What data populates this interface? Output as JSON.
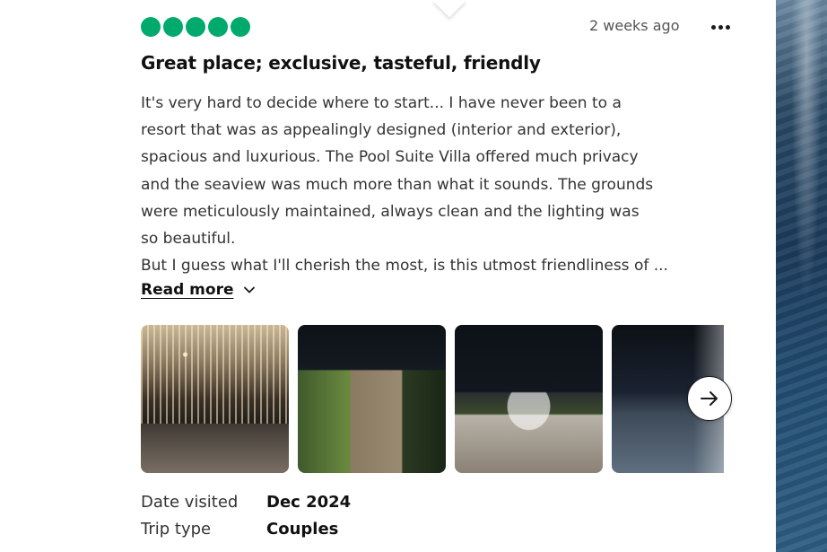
{
  "review": {
    "rating": 5,
    "rating_max": 5,
    "rating_color": "#00aa6c",
    "posted_ago": "2 weeks ago",
    "more_icon": "ellipsis-horizontal",
    "title": "Great place; exclusive, tasteful, friendly",
    "body_lines": [
      "It's very hard to decide where to start... I have never been to a",
      "resort that was as appealingly designed (interior and exterior),",
      "spacious and luxurious. The Pool Suite Villa offered much privacy",
      "and the seaview was much more than what it sounds. The grounds",
      "were meticulously maintained, always clean and the lighting was",
      "so beautiful.",
      "But I guess what I'll cherish the most, is this utmost friendliness of ..."
    ],
    "read_more_label": "Read more",
    "read_more_icon": "chevron-down",
    "gallery": {
      "photo_count_visible": 4,
      "next_icon": "arrow-right"
    },
    "details": [
      {
        "label": "Date visited",
        "value": "Dec 2024"
      },
      {
        "label": "Trip type",
        "value": "Couples"
      }
    ]
  }
}
